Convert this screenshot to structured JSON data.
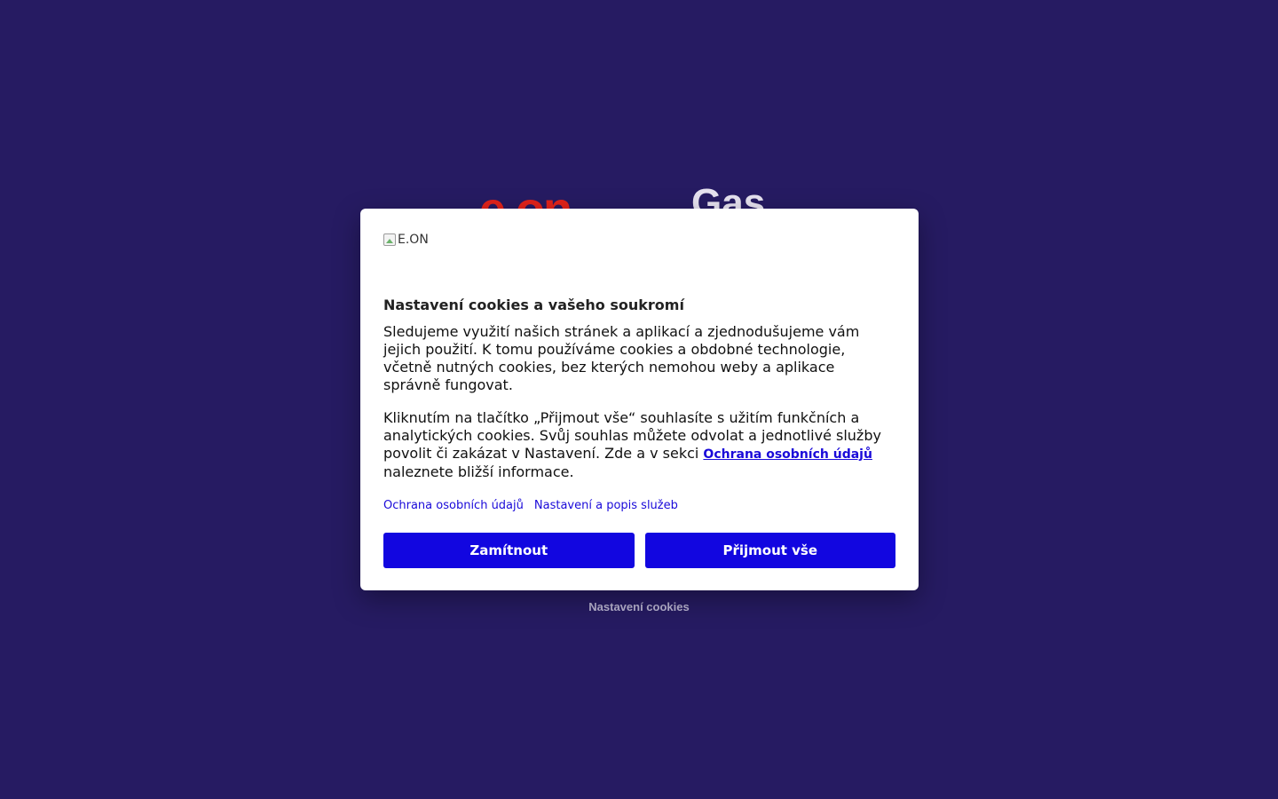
{
  "background": {
    "logo_eon": "e.on",
    "logo_gas": "Gas",
    "footer_link": "Nastavení cookies"
  },
  "modal": {
    "logo_alt": "E.ON",
    "title": "Nastavení cookies a vašeho soukromí",
    "paragraph1": "Sledujeme využití našich stránek a aplikací a zjednodušujeme vám jejich použití. K tomu používáme cookies a obdobné technologie, včetně nutných cookies, bez kterých nemohou weby a aplikace správně fungovat.",
    "paragraph2_before": "Kliknutím na tlačítko „Přijmout vše“ souhlasíte s užitím funkčních a analytických cookies. Svůj souhlas můžete odvolat a jednotlivé služby povolit či zakázat v Nastavení. Zde a v sekci ",
    "paragraph2_link": "Ochrana osobních údajů",
    "paragraph2_after": " naleznete bližší informace.",
    "link_privacy": "Ochrana osobních údajů",
    "link_settings": "Nastavení a popis služeb",
    "button_reject": "Zamítnout",
    "button_accept": "Přijmout vše"
  },
  "colors": {
    "background": "#261b62",
    "primary_button": "#1206e0",
    "link": "#1a0ad9",
    "brand_red": "#e2231a"
  }
}
